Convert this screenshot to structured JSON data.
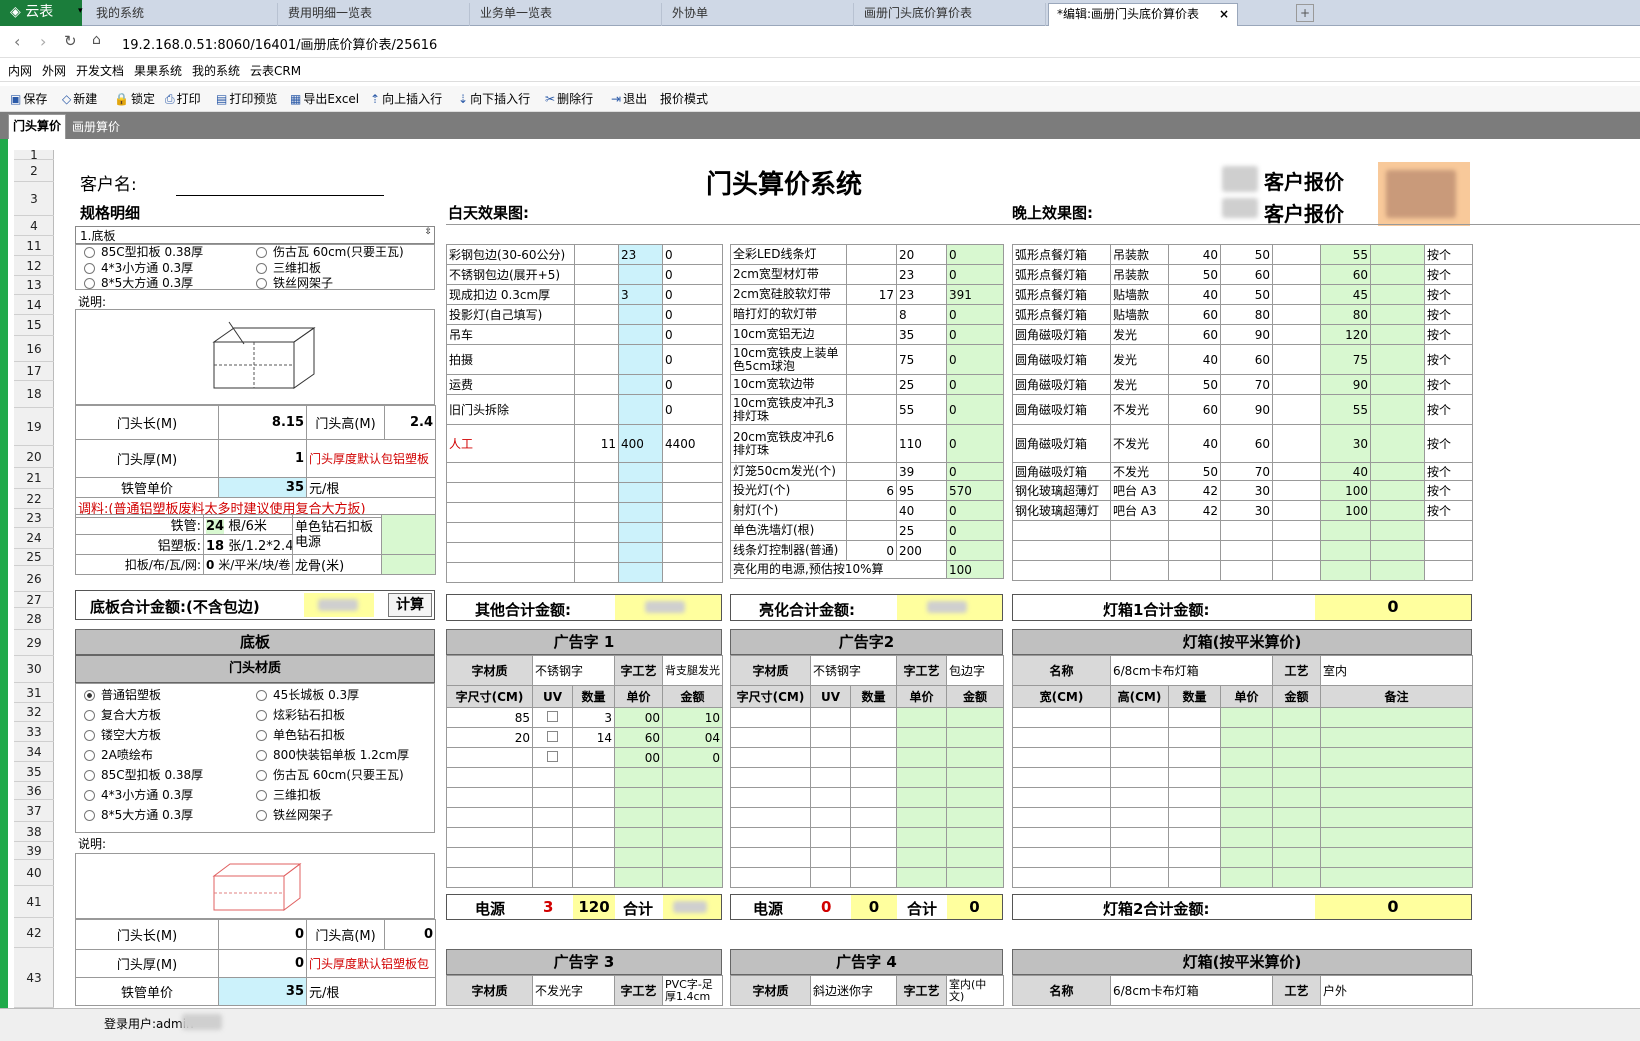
{
  "browser": {
    "logo": "云表",
    "tabs": [
      "我的系统",
      "费用明细一览表",
      "业务单一览表",
      "外协单",
      "画册门头底价算价表",
      "*编辑:画册门头底价算价表"
    ],
    "close": "×",
    "newtab": "+",
    "url": "19.2.168.0.51:8060/16401/画册底价算价表/25616"
  },
  "favorites": [
    "内网",
    "外网",
    "开发文档",
    "果果系统",
    "我的系统",
    "云表CRM"
  ],
  "toolbar": [
    "保存",
    "新建",
    "锁定",
    "打印",
    "打印预览",
    "导出Excel",
    "向上插入行",
    "向下插入行",
    "删除行",
    "退出",
    "报价模式"
  ],
  "sheets": [
    "门头算价",
    "画册算价"
  ],
  "rows": [
    "1",
    "2",
    "3",
    "4",
    "11",
    "12",
    "13",
    "14",
    "15",
    "16",
    "17",
    "18",
    "19",
    "20",
    "21",
    "22",
    "23",
    "24",
    "25",
    "26",
    "27",
    "28",
    "29",
    "30",
    "31",
    "32",
    "33",
    "34",
    "35",
    "36",
    "37",
    "38",
    "39",
    "40",
    "41",
    "42",
    "43"
  ],
  "header": {
    "customer_label": "客户名:",
    "title": "门头算价系统",
    "quote1": "客户报价",
    "quote2": "客户报价",
    "spec": "规格明细",
    "day": "白天效果图:",
    "night": "晚上效果图:",
    "select": "1.底板"
  },
  "left_top": {
    "radios": [
      "85C型扣板 0.38厚",
      "伤古瓦 60cm(只要王瓦)",
      "4*3小方通 0.3厚",
      "三维扣板",
      "8*5大方通 0.3厚",
      "铁丝网架子"
    ],
    "note": "说明:",
    "len_label": "门头长(M)",
    "len": "8.15",
    "high_label": "门头高(M)",
    "high": "2.4",
    "thick_label": "门头厚(M)",
    "thick": "1",
    "thick_note": "门头厚度默认包铝塑板",
    "pipe_label": "铁管单价",
    "pipe": "35",
    "pipe_unit": "元/根",
    "warn": "调料:(普通铝塑板废料太多时建议使用复合大方扳)",
    "tg_label": "铁管:",
    "tg": "24",
    "tg_unit": "根/6米",
    "lb_label": "铝塑板:",
    "lb": "18",
    "lb_unit": "张/1.2*2.4米",
    "kb_label": "扣板/布/瓦/网:",
    "kb": "0",
    "kb_unit": "米/平米/块/卷",
    "single": "单色钻石扣板电源",
    "keel": "龙骨(米)",
    "total_label": "底板合计金额:(不含包边)",
    "calc": "计算"
  },
  "mid_top": {
    "rows": [
      [
        "彩钢包边(30-60公分)",
        "",
        "23",
        "0"
      ],
      [
        "不锈钢包边(展开+5)",
        "",
        "",
        "0"
      ],
      [
        "现成扣边 0.3cm厚",
        "",
        "3",
        "0"
      ],
      [
        "投影灯(自己填写)",
        "",
        "",
        "0"
      ],
      [
        "吊车",
        "",
        "",
        "0"
      ],
      [
        "拍摄",
        "",
        "",
        "0"
      ],
      [
        "运费",
        "",
        "",
        "0"
      ],
      [
        "旧门头拆除",
        "",
        "",
        "0"
      ],
      [
        "人工",
        "11",
        "400",
        "4400"
      ]
    ],
    "total": "其他合计金额:"
  },
  "light": {
    "rows": [
      [
        "全彩LED线条灯",
        "",
        "20",
        "0"
      ],
      [
        "2cm宽型材灯带",
        "",
        "23",
        "0"
      ],
      [
        "2cm宽硅胶软灯带",
        "17",
        "23",
        "391"
      ],
      [
        "暗打灯的软灯带",
        "",
        "8",
        "0"
      ],
      [
        "10cm宽铝无边",
        "",
        "35",
        "0"
      ],
      [
        "10cm宽铁皮上装单色5cm球泡",
        "",
        "75",
        "0"
      ],
      [
        "10cm宽软边带",
        "",
        "25",
        "0"
      ],
      [
        "10cm宽铁皮冲孔3排灯珠",
        "",
        "55",
        "0"
      ],
      [
        "20cm宽铁皮冲孔6排灯珠",
        "",
        "110",
        "0"
      ],
      [
        "灯笼50cm发光(个)",
        "",
        "39",
        "0"
      ],
      [
        "投光灯(个)",
        "6",
        "95",
        "570"
      ],
      [
        "射灯(个)",
        "",
        "40",
        "0"
      ],
      [
        "单色洗墙灯(根)",
        "",
        "25",
        "0"
      ],
      [
        "线条灯控制器(普通)",
        "0",
        "200",
        "0"
      ],
      [
        "亮化用的电源,预估按10%算",
        "",
        "",
        "100"
      ]
    ],
    "total": "亮化合计金额:"
  },
  "lamp": {
    "rows": [
      [
        "弧形点餐灯箱",
        "吊装款",
        "40",
        "50",
        "",
        "55",
        "",
        "按个"
      ],
      [
        "弧形点餐灯箱",
        "吊装款",
        "50",
        "60",
        "",
        "60",
        "",
        "按个"
      ],
      [
        "弧形点餐灯箱",
        "贴墙款",
        "40",
        "50",
        "",
        "45",
        "",
        "按个"
      ],
      [
        "弧形点餐灯箱",
        "贴墙款",
        "60",
        "80",
        "",
        "80",
        "",
        "按个"
      ],
      [
        "圆角磁吸灯箱",
        "发光",
        "60",
        "90",
        "",
        "120",
        "",
        "按个"
      ],
      [
        "圆角磁吸灯箱",
        "发光",
        "40",
        "60",
        "",
        "75",
        "",
        "按个"
      ],
      [
        "圆角磁吸灯箱",
        "发光",
        "50",
        "70",
        "",
        "90",
        "",
        "按个"
      ],
      [
        "圆角磁吸灯箱",
        "不发光",
        "60",
        "90",
        "",
        "55",
        "",
        "按个"
      ],
      [
        "圆角磁吸灯箱",
        "不发光",
        "40",
        "60",
        "",
        "30",
        "",
        "按个"
      ],
      [
        "圆角磁吸灯箱",
        "不发光",
        "50",
        "70",
        "",
        "40",
        "",
        "按个"
      ],
      [
        "钢化玻璃超薄灯",
        "吧台 A3",
        "42",
        "30",
        "",
        "100",
        "",
        "按个"
      ],
      [
        "钢化玻璃超薄灯",
        "吧台 A3",
        "42",
        "30",
        "",
        "100",
        "",
        "按个"
      ]
    ],
    "total": "灯箱1合计金额:",
    "total_val": "0"
  },
  "base": {
    "title": "底板",
    "sub": "门头材质",
    "radios": [
      "普通铝塑板",
      "45长城板 0.3厚",
      "复合大方板",
      "炫彩钻石扣板",
      "镂空大方板",
      "单色钻石扣板",
      "2A喷绘布",
      "800快装铝单板 1.2cm厚",
      "85C型扣板 0.38厚",
      "伤古瓦 60cm(只要王瓦)",
      "4*3小方通 0.3厚",
      "三维扣板",
      "8*5大方通 0.3厚",
      "铁丝网架子"
    ],
    "note": "说明:",
    "len_label": "门头长(M)",
    "len": "0",
    "high_label": "门头高(M)",
    "high": "0",
    "thick_label": "门头厚(M)",
    "thick": "0",
    "thick_note": "门头厚度默认铝塑板包",
    "pipe_label": "铁管单价",
    "pipe": "35",
    "pipe_unit": "元/根"
  },
  "ad1": {
    "title": "广告字 1",
    "mat_label": "字材质",
    "mat": "不锈钢字",
    "craft_label": "字工艺",
    "craft": "背支腿发光",
    "cols": [
      "字尺寸(CM)",
      "UV",
      "数量",
      "单价",
      "金额"
    ],
    "rows": [
      [
        "85",
        "",
        "3",
        "00",
        "10"
      ],
      [
        "20",
        "",
        "14",
        "60",
        "04"
      ],
      [
        "",
        "",
        "",
        "00",
        "0"
      ]
    ],
    "power": "电源",
    "pw_n": "3",
    "pw_v": "120",
    "sum": "合计"
  },
  "ad2": {
    "title": "广告字2",
    "mat_label": "字材质",
    "mat": "不锈钢字",
    "craft_label": "字工艺",
    "craft": "包边字",
    "cols": [
      "字尺寸(CM)",
      "UV",
      "数量",
      "单价",
      "金额"
    ],
    "power": "电源",
    "pw_n": "0",
    "pw_v": "0",
    "sum": "合计",
    "sum_v": "0"
  },
  "box2": {
    "title": "灯箱(按平米算价)",
    "name_label": "名称",
    "name": "6/8cm卡布灯箱",
    "craft_label": "工艺",
    "craft": "室内",
    "cols": [
      "宽(CM)",
      "高(CM)",
      "数量",
      "单价",
      "金额",
      "备注"
    ],
    "total": "灯箱2合计金额:",
    "total_val": "0"
  },
  "ad3": {
    "title": "广告字 3",
    "mat_label": "字材质",
    "mat": "不发光字",
    "craft_label": "字工艺",
    "craft": "PVC字-足厚1.4cm"
  },
  "ad4": {
    "title": "广告字 4",
    "mat_label": "字材质",
    "mat": "斜边迷你字",
    "craft_label": "字工艺",
    "craft": "室内(中文)"
  },
  "box3": {
    "title": "灯箱(按平米算价)",
    "name_label": "名称",
    "name": "6/8cm卡布灯箱",
    "craft_label": "工艺",
    "craft": "户外"
  },
  "status": {
    "user": "登录用户:admin"
  }
}
